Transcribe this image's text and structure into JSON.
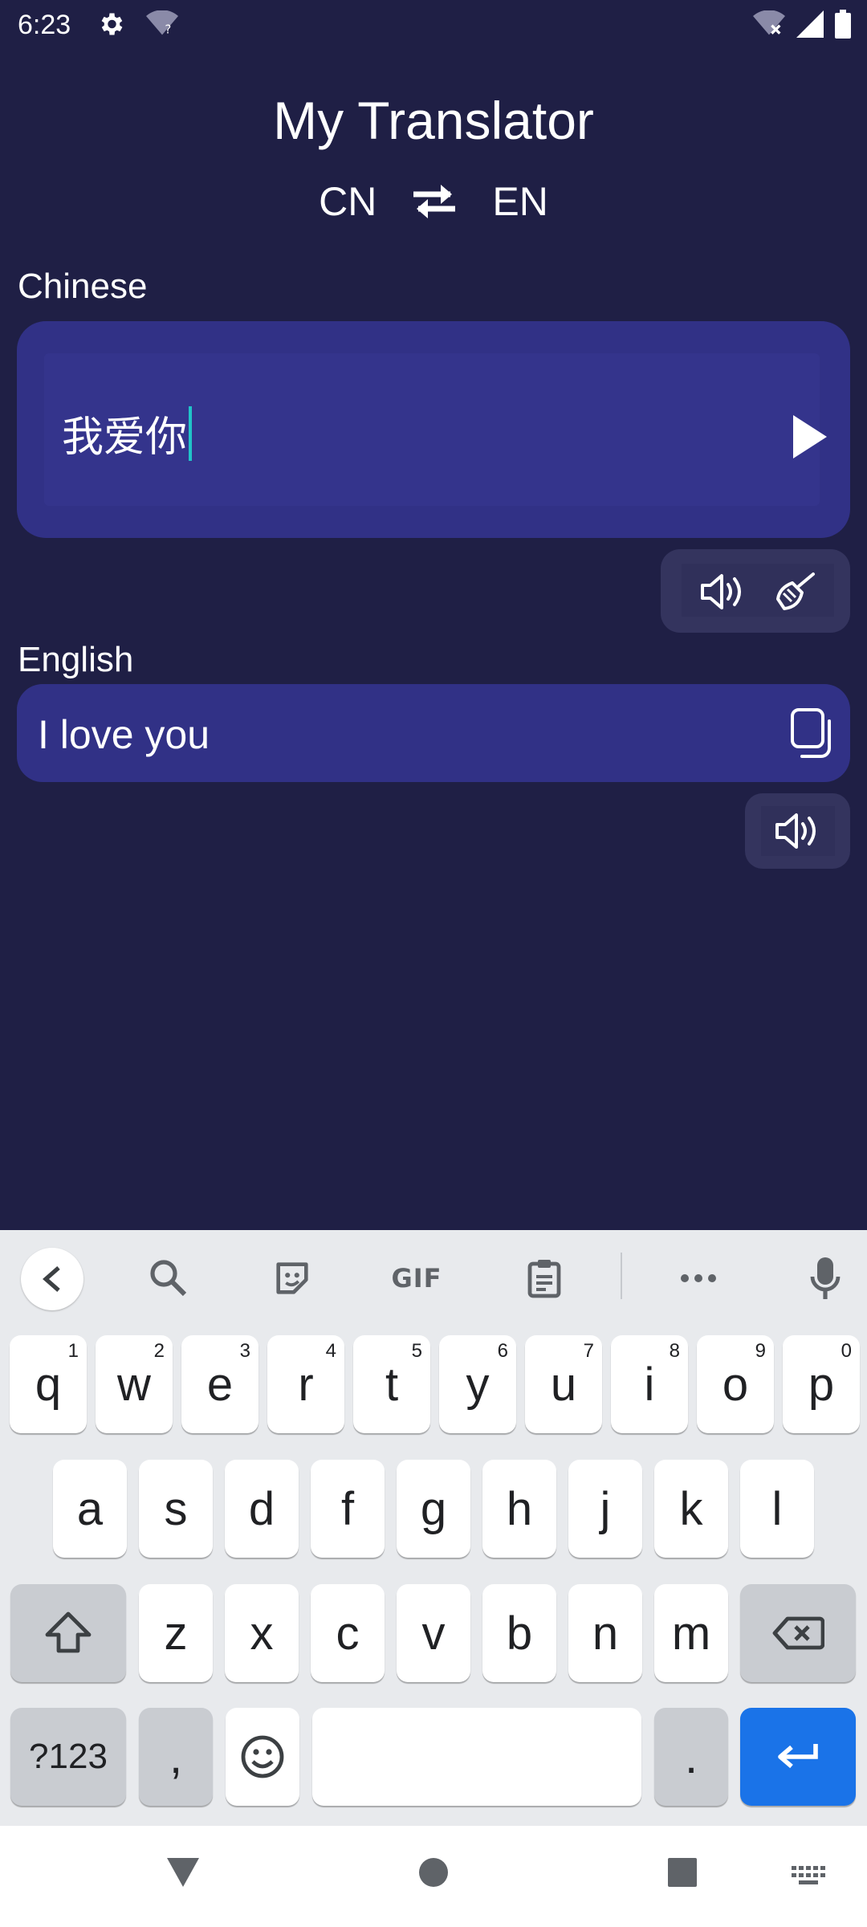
{
  "status_bar": {
    "time": "6:23",
    "left_icons": [
      "gear-icon",
      "wifi-question-icon"
    ],
    "right_icons": [
      "wifi-off-icon",
      "signal-icon",
      "battery-icon"
    ]
  },
  "header": {
    "title": "My Translator",
    "source_lang": "CN",
    "target_lang": "EN",
    "swap_icon": "swap-arrows-icon"
  },
  "source": {
    "label": "Chinese",
    "value": "我爱你",
    "send_icon": "play-triangle-icon",
    "tools": [
      "speaker-icon",
      "broom-icon"
    ]
  },
  "target": {
    "label": "English",
    "value": "I love you",
    "copy_icon": "copy-icon",
    "tools": [
      "speaker-icon"
    ]
  },
  "keyboard": {
    "toolbar": [
      "back-chevron-icon",
      "search-icon",
      "sticker-icon",
      "GIF",
      "clipboard-icon",
      "more-icon",
      "mic-icon"
    ],
    "gif_label": "GIF",
    "row1": [
      {
        "k": "q",
        "h": "1"
      },
      {
        "k": "w",
        "h": "2"
      },
      {
        "k": "e",
        "h": "3"
      },
      {
        "k": "r",
        "h": "4"
      },
      {
        "k": "t",
        "h": "5"
      },
      {
        "k": "y",
        "h": "6"
      },
      {
        "k": "u",
        "h": "7"
      },
      {
        "k": "i",
        "h": "8"
      },
      {
        "k": "o",
        "h": "9"
      },
      {
        "k": "p",
        "h": "0"
      }
    ],
    "row2": [
      "a",
      "s",
      "d",
      "f",
      "g",
      "h",
      "j",
      "k",
      "l"
    ],
    "row3": [
      "z",
      "x",
      "c",
      "v",
      "b",
      "n",
      "m"
    ],
    "symbols_key": "?123",
    "comma_key": ",",
    "period_key": ".",
    "accent_color": "#1a73e8"
  },
  "navbar": [
    "back-triangle-icon",
    "home-circle-icon",
    "recents-square-icon",
    "keyboard-switch-icon"
  ]
}
